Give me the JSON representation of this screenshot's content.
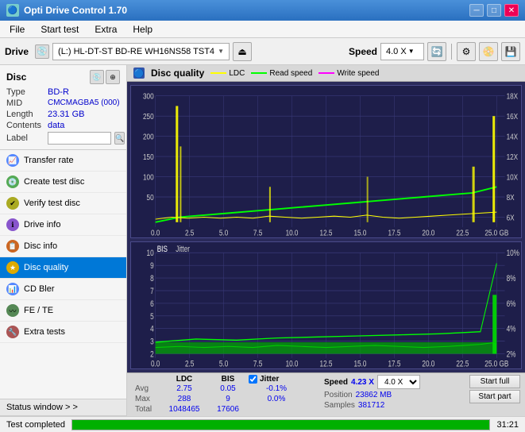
{
  "titleBar": {
    "title": "Opti Drive Control 1.70",
    "icon": "ODC",
    "controls": [
      "_",
      "□",
      "✕"
    ]
  },
  "menuBar": {
    "items": [
      "File",
      "Start test",
      "Extra",
      "Help"
    ]
  },
  "toolbar": {
    "driveLabel": "Drive",
    "driveValue": "(L:)  HL-DT-ST BD-RE  WH16NS58 TST4",
    "speedLabel": "Speed",
    "speedValue": "4.0 X"
  },
  "discPanel": {
    "title": "Disc",
    "rows": [
      {
        "key": "Type",
        "value": "BD-R",
        "color": "blue"
      },
      {
        "key": "MID",
        "value": "CMCMAGBA5 (000)",
        "color": "blue"
      },
      {
        "key": "Length",
        "value": "23.31 GB",
        "color": "blue"
      },
      {
        "key": "Contents",
        "value": "data",
        "color": "blue"
      }
    ],
    "labelKey": "Label",
    "labelValue": ""
  },
  "navItems": [
    {
      "id": "transfer-rate",
      "label": "Transfer rate",
      "icon": "📈",
      "active": false
    },
    {
      "id": "create-test-disc",
      "label": "Create test disc",
      "icon": "💿",
      "active": false
    },
    {
      "id": "verify-test-disc",
      "label": "Verify test disc",
      "icon": "✔",
      "active": false
    },
    {
      "id": "drive-info",
      "label": "Drive info",
      "icon": "ℹ",
      "active": false
    },
    {
      "id": "disc-info",
      "label": "Disc info",
      "icon": "📋",
      "active": false
    },
    {
      "id": "disc-quality",
      "label": "Disc quality",
      "icon": "★",
      "active": true
    },
    {
      "id": "cd-bler",
      "label": "CD Bler",
      "icon": "📊",
      "active": false
    },
    {
      "id": "fe-te",
      "label": "FE / TE",
      "icon": "〰",
      "active": false
    },
    {
      "id": "extra-tests",
      "label": "Extra tests",
      "icon": "🔧",
      "active": false
    }
  ],
  "statusWindow": {
    "label": "Status window > >"
  },
  "chartPanel": {
    "title": "Disc quality",
    "legend": [
      {
        "label": "LDC",
        "color": "#ffff00"
      },
      {
        "label": "Read speed",
        "color": "#00ff00"
      },
      {
        "label": "Write speed",
        "color": "#ff00ff"
      }
    ],
    "chart1": {
      "yMax": 300,
      "yRight": "18X",
      "xMax": "25.0 GB",
      "xLabels": [
        "0.0",
        "2.5",
        "5.0",
        "7.5",
        "10.0",
        "12.5",
        "15.0",
        "17.5",
        "20.0",
        "22.5",
        "25.0"
      ]
    },
    "chart2": {
      "title": "BIS",
      "legend2": "Jitter",
      "yMax": 10,
      "xMax": "25.0 GB"
    }
  },
  "stats": {
    "columns": [
      "",
      "LDC",
      "BIS",
      "",
      "Jitter",
      "Speed",
      ""
    ],
    "rows": [
      {
        "label": "Avg",
        "ldc": "2.75",
        "bis": "0.05",
        "jitter": "-0.1%",
        "position_label": "Position",
        "position_val": "23862 MB"
      },
      {
        "label": "Max",
        "ldc": "288",
        "bis": "9",
        "jitter": "0.0%",
        "samples_label": "Samples",
        "samples_val": "381712"
      },
      {
        "label": "Total",
        "ldc": "1048465",
        "bis": "17606",
        "jitter": ""
      }
    ],
    "jitterChecked": true,
    "speedDisplay": "4.23 X",
    "speedSelect": "4.0 X",
    "buttons": {
      "startFull": "Start full",
      "startPart": "Start part"
    }
  },
  "statusBar": {
    "message": "Test completed",
    "progress": 100,
    "time": "31:21"
  }
}
